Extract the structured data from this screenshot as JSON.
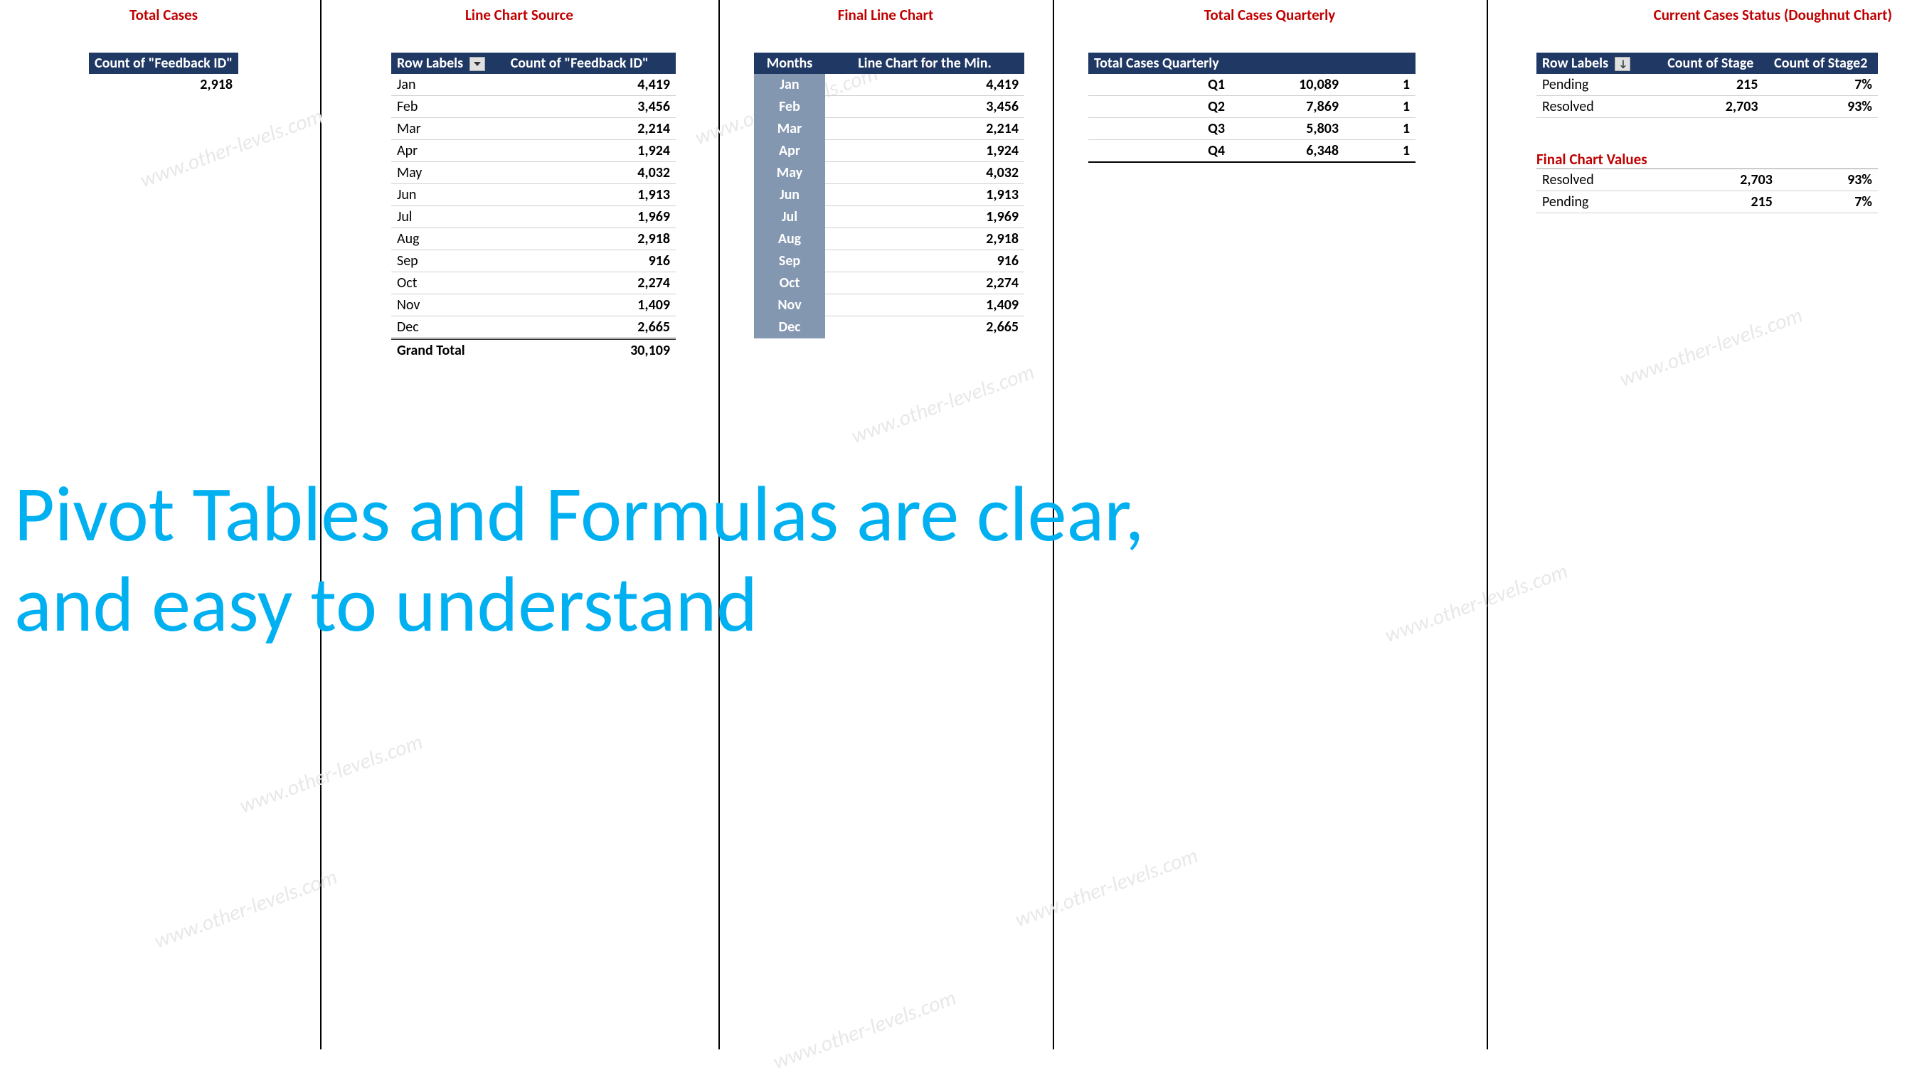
{
  "watermark": "www.other-levels.com",
  "big_caption_line1": "Pivot Tables and Formulas are clear,",
  "big_caption_line2": "and easy to understand",
  "total_cases": {
    "title": "Total Cases",
    "header": "Count of \"Feedback ID\"",
    "value": "2,918"
  },
  "line_chart_source": {
    "title": "Line Chart Source",
    "col1": "Row Labels",
    "col2": "Count of \"Feedback ID\"",
    "rows": [
      {
        "m": "Jan",
        "v": "4,419"
      },
      {
        "m": "Feb",
        "v": "3,456"
      },
      {
        "m": "Mar",
        "v": "2,214"
      },
      {
        "m": "Apr",
        "v": "1,924"
      },
      {
        "m": "May",
        "v": "4,032"
      },
      {
        "m": "Jun",
        "v": "1,913"
      },
      {
        "m": "Jul",
        "v": "1,969"
      },
      {
        "m": "Aug",
        "v": "2,918"
      },
      {
        "m": "Sep",
        "v": "916"
      },
      {
        "m": "Oct",
        "v": "2,274"
      },
      {
        "m": "Nov",
        "v": "1,409"
      },
      {
        "m": "Dec",
        "v": "2,665"
      }
    ],
    "grand_total_label": "Grand Total",
    "grand_total_value": "30,109"
  },
  "final_line_chart": {
    "title": "Final Line Chart",
    "col1": "Months",
    "col2": "Line Chart for the Min.",
    "rows": [
      {
        "m": "Jan",
        "v": "4,419"
      },
      {
        "m": "Feb",
        "v": "3,456"
      },
      {
        "m": "Mar",
        "v": "2,214"
      },
      {
        "m": "Apr",
        "v": "1,924"
      },
      {
        "m": "May",
        "v": "4,032"
      },
      {
        "m": "Jun",
        "v": "1,913"
      },
      {
        "m": "Jul",
        "v": "1,969"
      },
      {
        "m": "Aug",
        "v": "2,918"
      },
      {
        "m": "Sep",
        "v": "916"
      },
      {
        "m": "Oct",
        "v": "2,274"
      },
      {
        "m": "Nov",
        "v": "1,409"
      },
      {
        "m": "Dec",
        "v": "2,665"
      }
    ]
  },
  "quarterly": {
    "title": "Total Cases Quarterly",
    "header": "Total Cases Quarterly",
    "rows": [
      {
        "q": "Q1",
        "v": "10,089",
        "f": "1"
      },
      {
        "q": "Q2",
        "v": "7,869",
        "f": "1"
      },
      {
        "q": "Q3",
        "v": "5,803",
        "f": "1"
      },
      {
        "q": "Q4",
        "v": "6,348",
        "f": "1"
      }
    ]
  },
  "doughnut": {
    "title": "Current Cases Status (Doughnut Chart)",
    "col1": "Row Labels",
    "col2": "Count of Stage",
    "col3": "Count of Stage2",
    "rows": [
      {
        "s": "Pending",
        "c": "215",
        "p": "7%"
      },
      {
        "s": "Resolved",
        "c": "2,703",
        "p": "93%"
      }
    ],
    "final_title": "Final Chart Values",
    "final_rows": [
      {
        "s": "Resolved",
        "c": "2,703",
        "p": "93%"
      },
      {
        "s": "Pending",
        "c": "215",
        "p": "7%"
      }
    ]
  }
}
